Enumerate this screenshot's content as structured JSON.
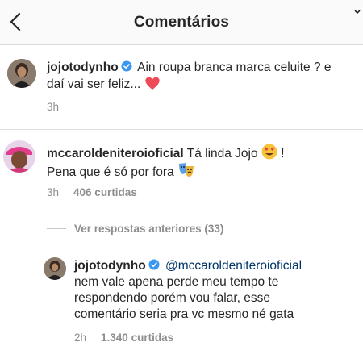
{
  "header": {
    "title": "Comentários"
  },
  "comments": [
    {
      "username": "jojotodynho",
      "verified": true,
      "text": "Ain roupa branca marca celuite ? e daí vai ser feliz...",
      "emoji": "heart-emoji",
      "time": "3h"
    },
    {
      "username": "mccaroldeniteroioficial",
      "verified": false,
      "text_line1": "Tá linda Jojo",
      "text_line1_end": "!",
      "text_line2": "Pena que é só por fora",
      "emoji1": "heart-eyes-emoji",
      "emoji2": "theater-masks-emoji",
      "time": "3h",
      "likes": "406 curtidas"
    }
  ],
  "view_replies_label": "Ver respostas anteriores (33)",
  "reply": {
    "username": "jojotodynho",
    "verified": true,
    "mention": "@mccaroldeniteroioficial",
    "line1": "nem vale apena perde meu tempo  te",
    "line2": "respondendo porém  vou falar, esse",
    "line3": "comentário  seria pra vc  mesmo né  gata",
    "time": "2h",
    "likes": "1.340 curtidas"
  },
  "colors": {
    "verified_badge": "#3897f0",
    "heart": "#ed4956",
    "meta_text": "#8e8e8e",
    "mention": "#003569"
  }
}
